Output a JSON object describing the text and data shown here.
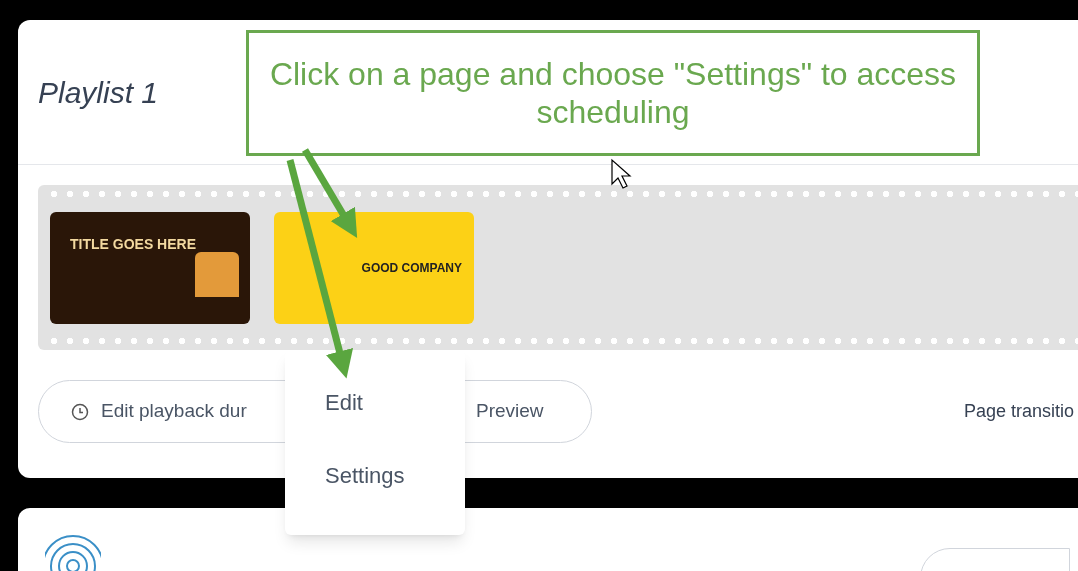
{
  "playlist": {
    "title": "Playlist 1",
    "pages": [
      {
        "kind": "dark",
        "title": "TITLE GOES HERE"
      },
      {
        "kind": "yellow",
        "title": "GOOD COMPANY"
      }
    ],
    "actions": {
      "duration": "Edit playback dur",
      "preview": "Preview"
    },
    "transition_label": "Page transitio"
  },
  "context_menu": {
    "items": [
      "Edit",
      "Settings"
    ]
  },
  "annotation": {
    "text": "Click on a page and choose \"Settings\" to access scheduling"
  }
}
